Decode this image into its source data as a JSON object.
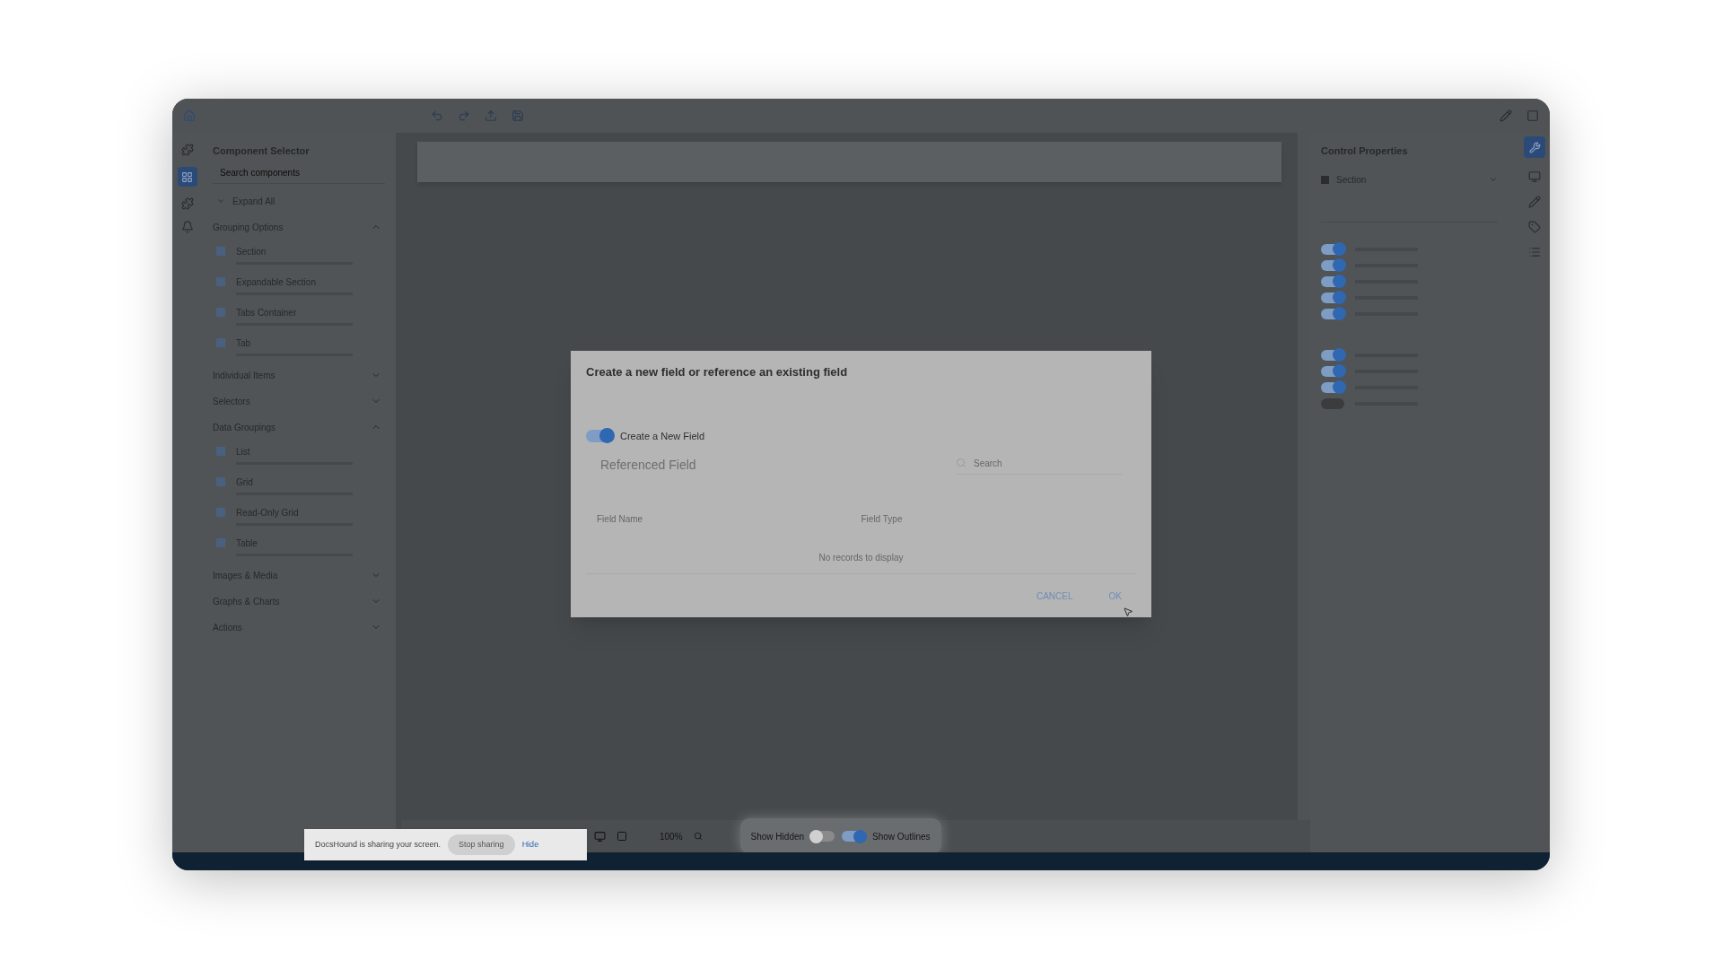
{
  "left_panel": {
    "title": "Component Selector",
    "search": {
      "placeholder": "Search components"
    },
    "expand_all": "Expand All",
    "groups": [
      {
        "label": "Grouping Options",
        "expanded": true,
        "items": [
          "Section",
          "Expandable Section",
          "Tabs Container",
          "Tab"
        ]
      },
      {
        "label": "Individual Items",
        "expanded": false
      },
      {
        "label": "Selectors",
        "expanded": false
      },
      {
        "label": "Data Groupings",
        "expanded": true,
        "items": [
          "List",
          "Grid",
          "Read-Only Grid",
          "Table"
        ]
      },
      {
        "label": "Images & Media",
        "expanded": false
      },
      {
        "label": "Graphs & Charts",
        "expanded": false
      },
      {
        "label": "Actions",
        "expanded": false
      }
    ]
  },
  "right_panel": {
    "title": "Control Properties",
    "control": "Section",
    "toggles": [
      {
        "on": true
      },
      {
        "on": true
      },
      {
        "on": true
      },
      {
        "on": true
      },
      {
        "on": true
      },
      {
        "on": true
      },
      {
        "on": true
      },
      {
        "on": true
      },
      {
        "on": false
      }
    ]
  },
  "dialog": {
    "title": "Create a new field or reference an existing field",
    "toggle": {
      "label": "Create a New Field",
      "on": true
    },
    "referenced_field": {
      "placeholder": "Referenced Field"
    },
    "search": {
      "placeholder": "Search"
    },
    "table": {
      "columns": [
        "Field Name",
        "Field Type"
      ],
      "empty": "No records to display"
    },
    "buttons": [
      "CANCEL",
      "OK"
    ]
  },
  "bottom_bar": {
    "zoom": "100%",
    "show_hidden": {
      "label": "Show Hidden",
      "on": false
    },
    "show_outlines": {
      "label": "Show Outlines",
      "on": true
    }
  },
  "share_notice": {
    "text": "DocsHound is sharing your screen.",
    "stop": "Stop sharing",
    "hide": "Hide"
  }
}
